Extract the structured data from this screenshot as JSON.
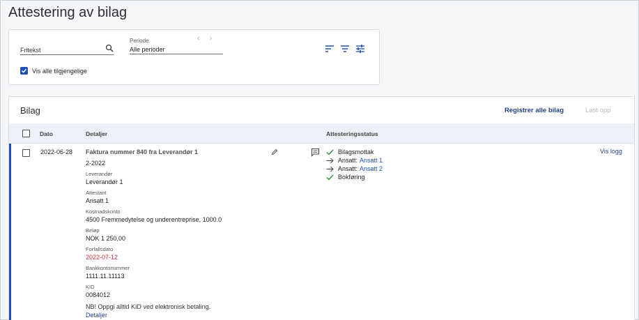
{
  "page": {
    "title": "Attestering av bilag"
  },
  "filters": {
    "fritekst_placeholder": "Fritekst",
    "periode_label": "Periode",
    "periode_value": "Alle perioder",
    "prev_glyph": "‹",
    "next_glyph": "›",
    "checkbox_label": "Vis alle tilgjengelige",
    "checkbox_checked": true,
    "icons": [
      "sort-icon",
      "filter-icon",
      "tune-icon"
    ]
  },
  "bilag": {
    "title": "Bilag",
    "registrer_label": "Registrer alle bilag",
    "last_opp_label": "Last opp",
    "columns": {
      "dato": "Dato",
      "detaljer": "Detaljer",
      "status": "Attesteringsstatus"
    },
    "row": {
      "dato": "2022-06-28",
      "title": "Faktura nummer 840 fra Leverandør 1",
      "periode": "2-2022",
      "fields": [
        {
          "label": "Leverandør",
          "value": "Leverandør 1"
        },
        {
          "label": "Attestant",
          "value": "Ansatt 1"
        },
        {
          "label": "Kostnadskonto",
          "value": "4500 Fremmedytelse og underentreprise, 1000.0"
        },
        {
          "label": "Beløp",
          "value": "NOK 1 250,00"
        },
        {
          "label": "Forfallsdato",
          "value": "2022-07-12"
        },
        {
          "label": "Bankkontonummer",
          "value": "1111.11.11113"
        },
        {
          "label": "KID",
          "value": "0084012"
        }
      ],
      "note": "NB! Oppgi alltid KID ved elektronisk betaling.",
      "detaljer_link": "Detaljer",
      "status": [
        {
          "icon": "check-icon",
          "text": "Bilagsmottak",
          "link": ""
        },
        {
          "icon": "arrow-right-icon",
          "text": "Ansatt:",
          "link": "Ansatt 1"
        },
        {
          "icon": "arrow-right-icon",
          "text": "Ansatt:",
          "link": "Ansatt 2"
        },
        {
          "icon": "check-icon",
          "text": "Bokføring",
          "link": ""
        }
      ],
      "vis_logg": "Vis logg"
    }
  },
  "colors": {
    "accent": "#1f4fbf",
    "link": "#1f3f8f",
    "danger": "#d02c3a",
    "check": "#2e8b3e"
  }
}
